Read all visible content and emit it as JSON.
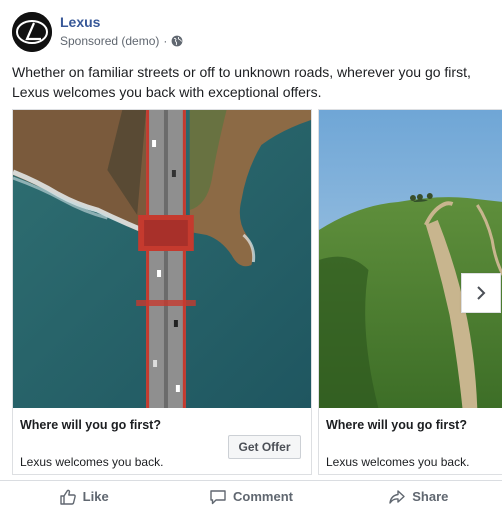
{
  "post": {
    "page_name": "Lexus",
    "sponsored_label": "Sponsored (demo)",
    "separator": "·",
    "privacy_icon": "globe-icon",
    "logo_icon": "lexus-logo-icon",
    "caption": "Whether on familiar streets or off to unknown roads, wherever you go first, Lexus welcomes you back with exceptional offers."
  },
  "carousel": {
    "cards": [
      {
        "image": "golden-gate-bridge-aerial",
        "title": "Where will you go first?",
        "subtitle": "Lexus welcomes you back.",
        "cta_label": "Get Offer"
      },
      {
        "image": "green-hills-dirt-road",
        "title": "Where will you go first?",
        "subtitle": "Lexus welcomes you back."
      }
    ],
    "next_icon": "chevron-right-icon"
  },
  "actions": {
    "like": {
      "label": "Like",
      "icon": "thumbs-up-icon"
    },
    "comment": {
      "label": "Comment",
      "icon": "comment-icon"
    },
    "share": {
      "label": "Share",
      "icon": "share-icon"
    }
  },
  "colors": {
    "link": "#385898",
    "text": "#1c1e21",
    "muted": "#606770",
    "border": "#dddfe2"
  }
}
